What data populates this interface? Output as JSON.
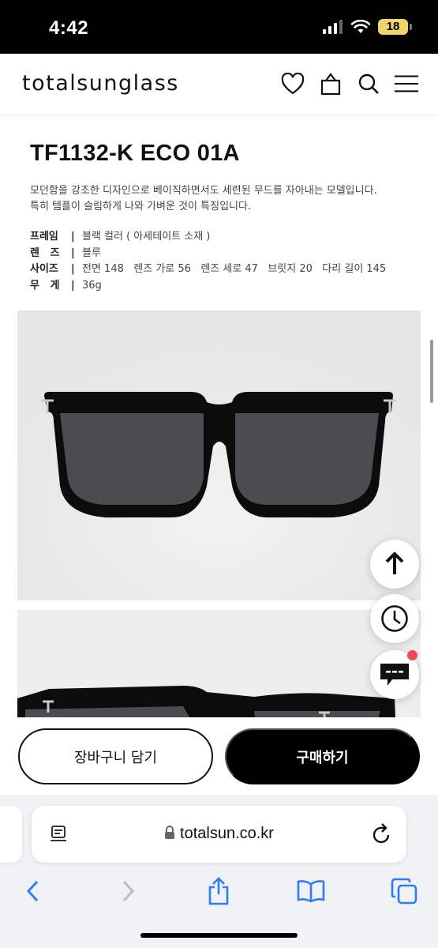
{
  "status_bar": {
    "time": "4:42",
    "battery": "18"
  },
  "header": {
    "logo": "totalsunglass"
  },
  "product": {
    "title": "TF1132-K ECO 01A",
    "description": [
      "모던함을 강조한 디자인으로 베이직하면서도 세련된 무드를 자아내는 모델입니다.",
      "특히 템플이 슬림하게 나와 가벼운 것이 특징입니다."
    ],
    "specs": [
      {
        "label": "프레임",
        "value": "블랙 컬러 ( 아세테이트 소재 )"
      },
      {
        "label": "렌   즈",
        "value": "블루"
      },
      {
        "label": "사이즈",
        "value": "전면 148   렌즈 가로 56   렌즈 세로 47   브릿지 20   다리 길이 145"
      },
      {
        "label": "무   게",
        "value": "36g"
      }
    ],
    "separator": "|"
  },
  "actions": {
    "cart_label": "장바구니 담기",
    "buy_label": "구매하기"
  },
  "browser": {
    "url": "totalsun.co.kr"
  },
  "colors": {
    "accent": "#000000",
    "notification": "#f0485a",
    "battery": "#f1d56a",
    "safari_blue": "#2f7cf6"
  }
}
